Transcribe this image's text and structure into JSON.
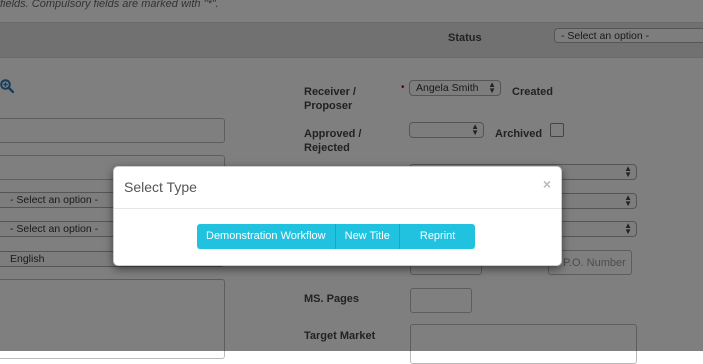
{
  "page": {
    "note": "fields. Compulsory fields are marked with \"*\"."
  },
  "header": {
    "status_label": "Status",
    "status_select": "- Select an option -"
  },
  "left_column": {
    "select_1": "- Select an option -",
    "select_2": "- Select an option -",
    "language": "English"
  },
  "right_column": {
    "receiver_label": "Receiver / Proposer",
    "receiver_value": "Angela Smith",
    "created_label": "Created",
    "approved_label": "Approved / Rejected",
    "archived_label": "Archived",
    "po_placeholder": "P.O. Number",
    "ms_pages_label": "MS. Pages",
    "target_market_label": "Target Market"
  },
  "modal": {
    "title": "Select Type",
    "close": "×",
    "buttons": [
      "Demonstration Workflow",
      "New Title",
      "Reprint"
    ]
  },
  "colors": {
    "accent": "#21c2e0",
    "required": "#cc0000"
  }
}
